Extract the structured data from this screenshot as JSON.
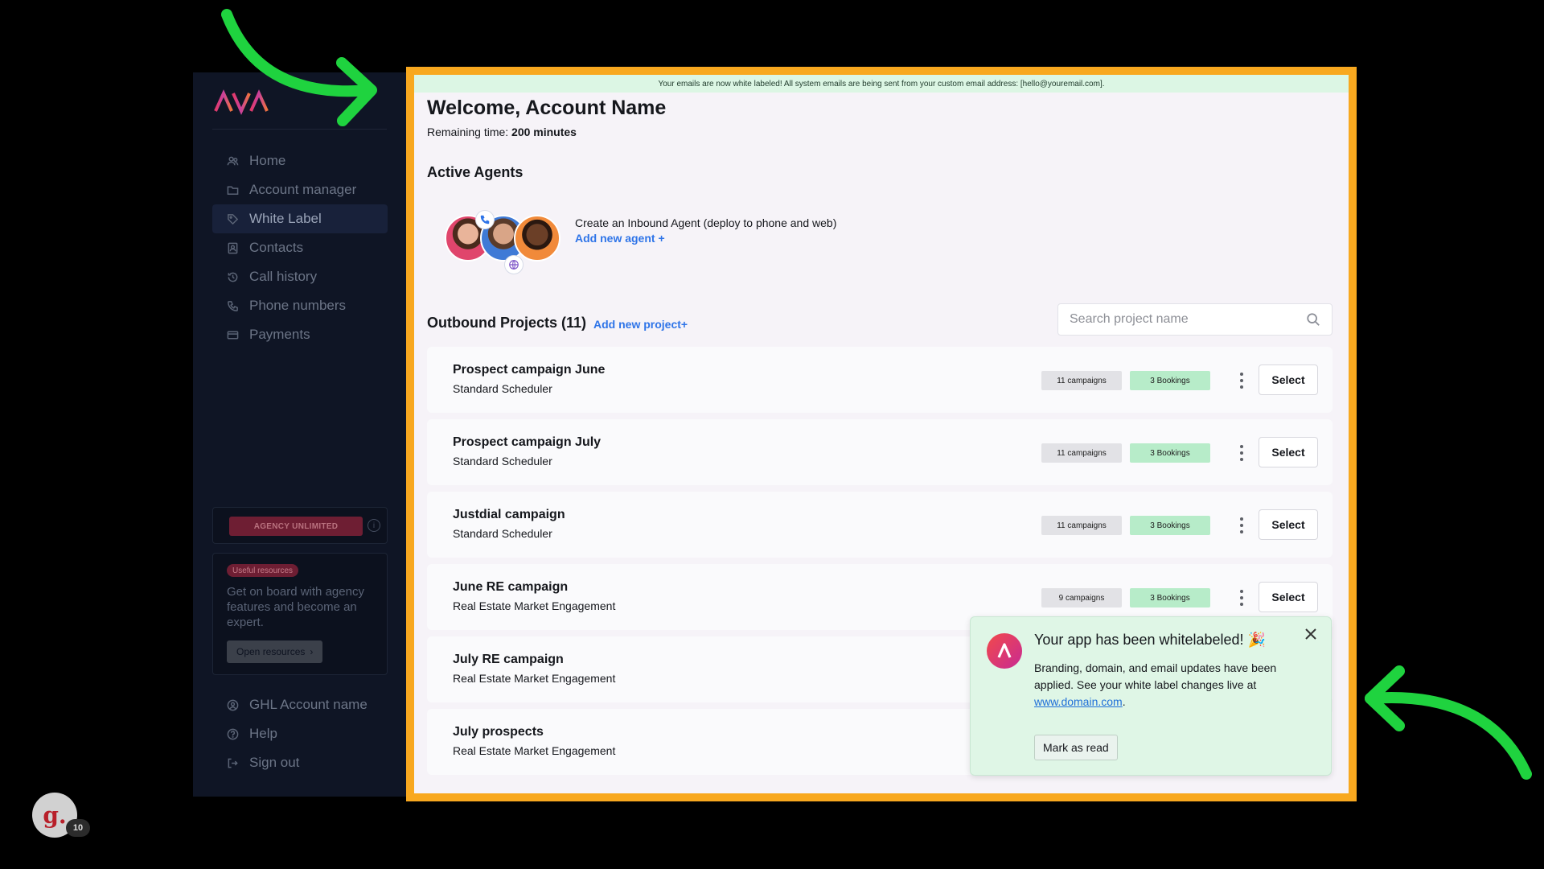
{
  "brand": {
    "logo_text": "AVA"
  },
  "sidebar": {
    "items": [
      {
        "label": "Home",
        "icon": "users-icon"
      },
      {
        "label": "Account manager",
        "icon": "folder-icon"
      },
      {
        "label": "White Label",
        "icon": "tag-icon",
        "active": true
      },
      {
        "label": "Contacts",
        "icon": "contacts-icon"
      },
      {
        "label": "Call history",
        "icon": "history-icon"
      },
      {
        "label": "Phone numbers",
        "icon": "phone-icon"
      },
      {
        "label": "Payments",
        "icon": "card-icon"
      }
    ],
    "plan_badge": "AGENCY UNLIMITED",
    "plan_info": "i",
    "resources": {
      "badge": "Useful resources",
      "text": "Get on board with agency features and become an expert.",
      "button": "Open resources",
      "button_chevron": "›"
    },
    "bottom_items": [
      {
        "label": "GHL Account name",
        "icon": "user-circle-icon"
      },
      {
        "label": "Help",
        "icon": "help-icon"
      },
      {
        "label": "Sign out",
        "icon": "sign-out-icon"
      }
    ]
  },
  "user_avatar": {
    "letter": "g.",
    "count": "10"
  },
  "banner": "Your emails are now white labeled! All system emails are being sent from your custom email address: [hello@youremail.com].",
  "welcome": "Welcome, Account Name",
  "remaining": {
    "label": "Remaining time: ",
    "value": "200 minutes"
  },
  "active_agents": {
    "title": "Active Agents",
    "text": "Create an Inbound Agent (deploy to phone and web)",
    "link": "Add new agent +"
  },
  "outbound": {
    "title": "Outbound Projects (11)",
    "link": "Add new project+",
    "search_placeholder": "Search project name",
    "projects": [
      {
        "name": "Prospect campaign June",
        "sub": "Standard Scheduler",
        "campaigns": "11 campaigns",
        "bookings": "3 Bookings",
        "select": "Select"
      },
      {
        "name": "Prospect campaign July",
        "sub": "Standard Scheduler",
        "campaigns": "11 campaigns",
        "bookings": "3 Bookings",
        "select": "Select"
      },
      {
        "name": "Justdial campaign",
        "sub": "Standard Scheduler",
        "campaigns": "11 campaigns",
        "bookings": "3 Bookings",
        "select": "Select"
      },
      {
        "name": "June RE campaign",
        "sub": "Real Estate Market Engagement",
        "campaigns": "9 campaigns",
        "bookings": "3 Bookings",
        "select": "Select"
      },
      {
        "name": "July RE campaign",
        "sub": "Real Estate Market Engagement"
      },
      {
        "name": "July prospects",
        "sub": "Real Estate Market Engagement"
      }
    ]
  },
  "toast": {
    "title": "Your app has been whitelabeled! 🎉",
    "body": "Branding, domain, and email updates have been applied. See your white label changes live at ",
    "link": "www.domain.com",
    "body_end": ".",
    "button": "Mark as read"
  },
  "colors": {
    "frame": "#f8a81f",
    "arrow": "#1fd33f",
    "link": "#2e74e8",
    "sidebar": "#0f1525"
  }
}
